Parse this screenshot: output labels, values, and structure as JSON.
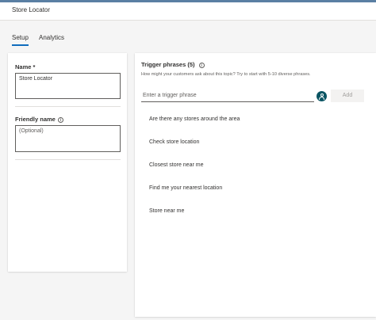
{
  "window": {
    "title": "Store Locator"
  },
  "tabs": [
    {
      "label": "Setup",
      "selected": true
    },
    {
      "label": "Analytics",
      "selected": false
    }
  ],
  "left_panel": {
    "name_label": "Name *",
    "name_value": "Store Locator",
    "friendly_name_label": "Friendly name",
    "friendly_name_placeholder": "(Optional)"
  },
  "trigger_panel": {
    "header": "Trigger phrases (5)",
    "description": "How might your customers ask about this topic? Try to start with 5-10 diverse phrases.",
    "input_placeholder": "Enter a trigger phrase",
    "add_label": "Add",
    "phrases": [
      "Are there any stores around the area",
      "Check store location",
      "Closest store near me",
      "Find me your nearest location",
      "Store near me"
    ]
  },
  "icons": {
    "info": "info-icon",
    "copilot": "copilot-person-icon"
  },
  "colors": {
    "accent": "#0f6cbd",
    "copilot_icon": "#0b5563",
    "top_border": "#5a7fa3"
  }
}
